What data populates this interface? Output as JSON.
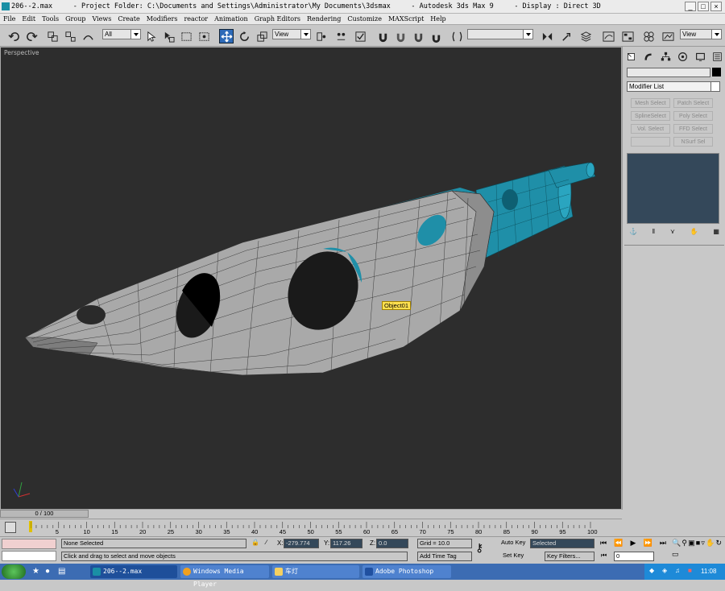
{
  "window": {
    "title": "206--2.max     - Project Folder: C:\\Documents and Settings\\Administrator\\My Documents\\3dsmax     - Autodesk 3ds Max 9     - Display : Direct 3D",
    "controls": [
      "_",
      "□",
      "×"
    ]
  },
  "menu": [
    "File",
    "Edit",
    "Tools",
    "Group",
    "Views",
    "Create",
    "Modifiers",
    "reactor",
    "Animation",
    "Graph Editors",
    "Rendering",
    "Customize",
    "MAXScript",
    "Help"
  ],
  "toolbar": {
    "selection_filter": "All",
    "ref_coord": "View",
    "named_selection": "",
    "view_right": "View"
  },
  "viewport": {
    "label": "Perspective",
    "object_tooltip": "Object01"
  },
  "command_panel": {
    "object_name": "",
    "modifier_list": "Modifier List",
    "buttons": [
      "Mesh Select",
      "Patch Select",
      "SplineSelect",
      "Poly Select",
      "Vol. Select",
      "FFD Select",
      "",
      "NSurf Sel"
    ]
  },
  "time_slider": {
    "label": "0 / 100"
  },
  "track": {
    "ticks": [
      "5",
      "10",
      "15",
      "20",
      "25",
      "30",
      "35",
      "40",
      "45",
      "50",
      "55",
      "60",
      "65",
      "70",
      "75",
      "80",
      "85",
      "90",
      "95",
      "100"
    ]
  },
  "status": {
    "selection": "None Selected",
    "prompt": "Click and drag to select and move objects",
    "x_label": "X:",
    "x_value": "-279.774",
    "y_label": "Y:",
    "y_value": "117.26",
    "z_label": "Z:",
    "z_value": "0.0",
    "grid": "Grid = 10.0",
    "add_time_tag": "Add Time Tag",
    "auto_key": "Auto Key",
    "auto_key_mode": "Selected",
    "set_key": "Set Key",
    "key_filters": "Key Filters...",
    "frame": "0"
  },
  "taskbar": {
    "items": [
      "206--2.max",
      "Windows Media Player",
      "车灯",
      "Adobe Photoshop"
    ],
    "clock": "11:08"
  },
  "colors": {
    "viewport_bg": "#2d2d2d",
    "object_fill": "#a9a9a9",
    "object_secondary": "#1f8fa8",
    "wireframe": "#303030",
    "taskbar": "#3c6cb3",
    "tooltip": "#ffe050"
  }
}
